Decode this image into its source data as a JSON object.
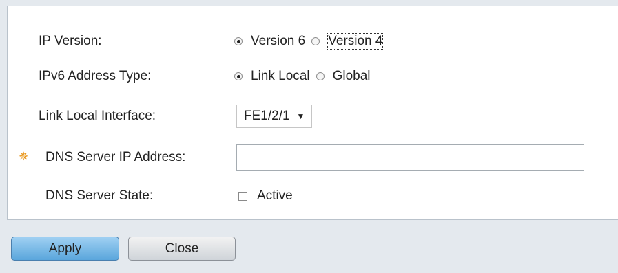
{
  "form": {
    "ip_version": {
      "label": "IP Version:",
      "options": [
        "Version 6",
        "Version 4"
      ],
      "selected": "Version 6"
    },
    "ipv6_address_type": {
      "label": "IPv6 Address Type:",
      "options": [
        "Link Local",
        "Global"
      ],
      "selected": "Link Local"
    },
    "link_local_interface": {
      "label": "Link Local Interface:",
      "value": "FE1/2/1"
    },
    "dns_server_ip": {
      "label": "DNS Server IP Address:",
      "value": "",
      "required": true
    },
    "dns_server_state": {
      "label": "DNS Server State:",
      "checkbox_label": "Active",
      "checked": false
    }
  },
  "buttons": {
    "apply": "Apply",
    "close": "Close"
  },
  "colors": {
    "required_icon": "#e8900c",
    "apply_button": "#5aa6dc"
  }
}
